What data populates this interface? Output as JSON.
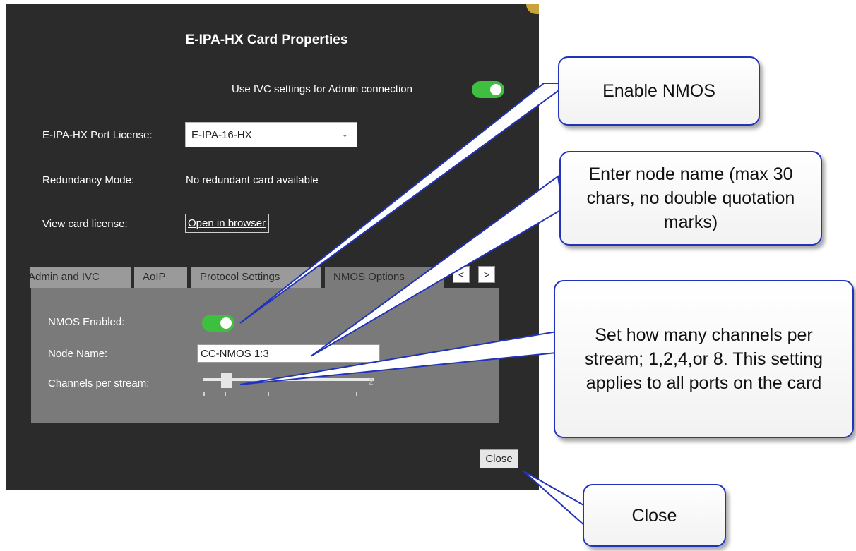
{
  "dialog": {
    "title": "E-IPA-HX Card Properties",
    "ivc_toggle_label": "Use IVC settings for Admin connection",
    "ivc_toggle_on": true,
    "port_license_label": "E-IPA-HX Port License:",
    "port_license_value": "E-IPA-16-HX",
    "redundancy_label": "Redundancy Mode:",
    "redundancy_value": "No redundant card available",
    "view_license_label": "View card license:",
    "open_browser_label": "Open in browser",
    "tabs": [
      {
        "label": "Admin and IVC",
        "active": false
      },
      {
        "label": "AoIP",
        "active": false
      },
      {
        "label": "Protocol Settings",
        "active": false
      },
      {
        "label": "NMOS Options",
        "active": true
      }
    ],
    "tab_prev": "<",
    "tab_next": ">",
    "nmos_enabled_label": "NMOS Enabled:",
    "nmos_enabled_on": true,
    "node_name_label": "Node Name:",
    "node_name_value": "CC-NMOS 1:3",
    "channels_label": "Channels per stream:",
    "slider_value_text": "2",
    "slider_fraction": 0.14,
    "close_label": "Close"
  },
  "callouts": {
    "enable_nmos": "Enable NMOS",
    "node_name": "Enter node name (max 30 chars, no double quotation marks)",
    "channels": "Set how many channels per stream; 1,2,4,or 8. This setting applies to all ports on the card",
    "close": "Close"
  },
  "colors": {
    "dialog_bg": "#2b2b2b",
    "panel_bg": "#7a7a7a",
    "toggle_on": "#3fbf3f",
    "callout_border": "#2233bb"
  }
}
